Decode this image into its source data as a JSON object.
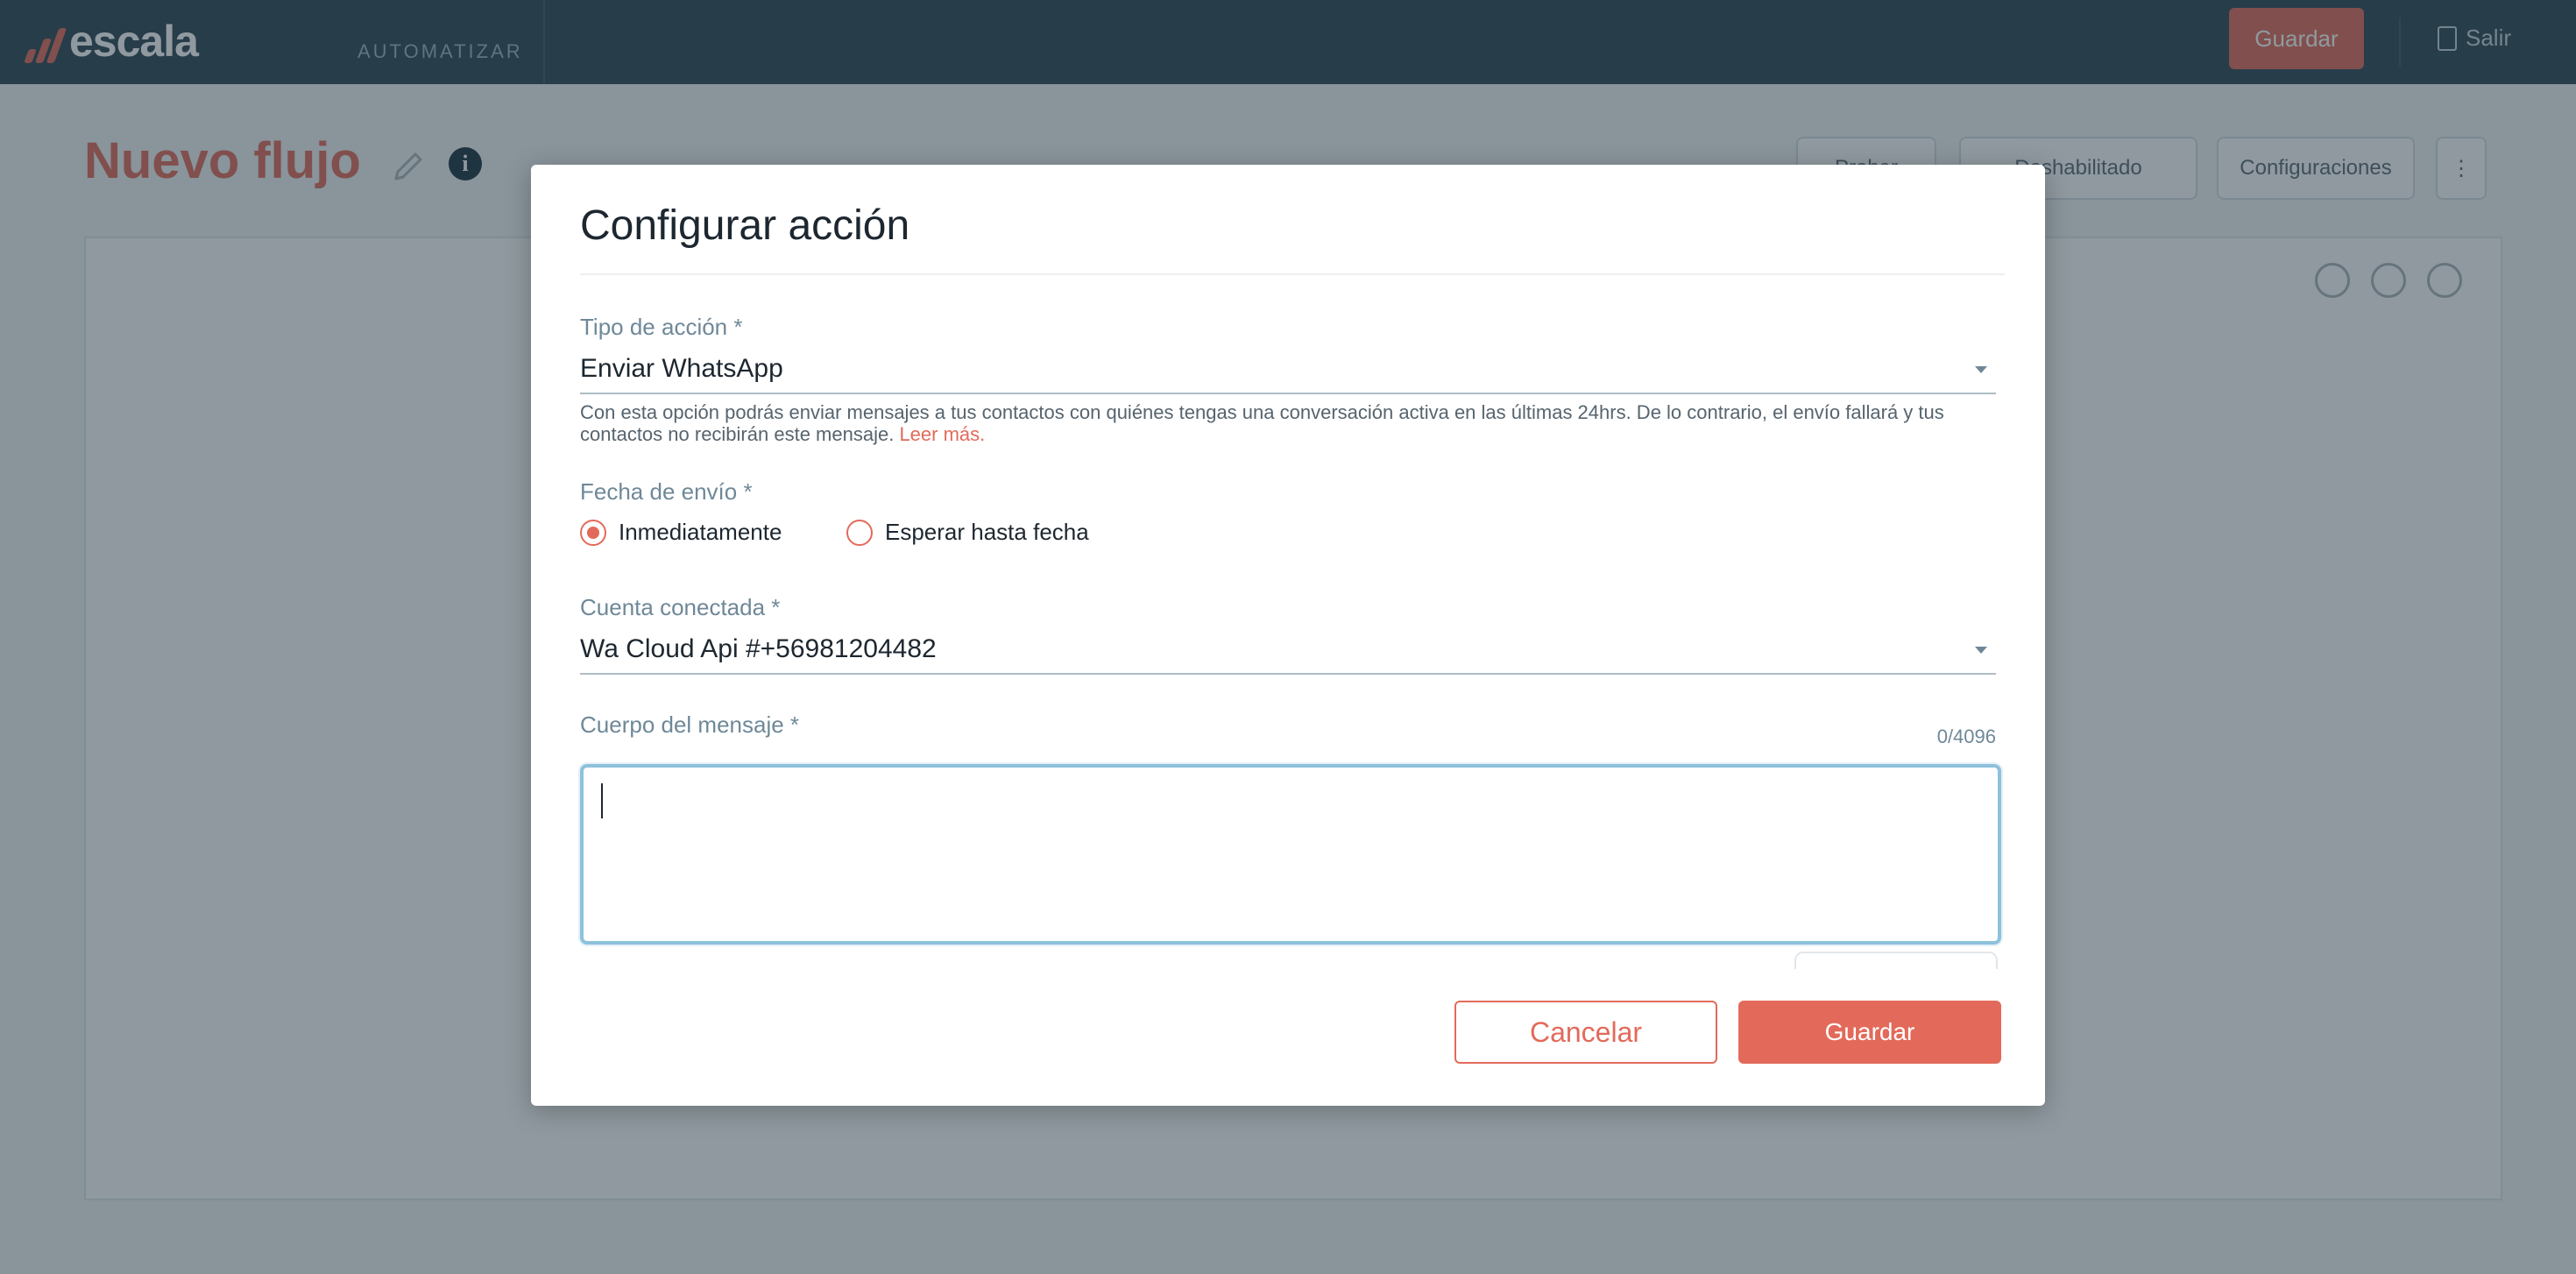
{
  "app": {
    "brand": "escala",
    "module": "AUTOMATIZAR",
    "save_label": "Guardar",
    "exit_label": "Salir"
  },
  "flow": {
    "title": "Nuevo flujo",
    "toolbar": {
      "probar_label": "Probar",
      "status_label": "Deshabilitado",
      "settings_label": "Configuraciones",
      "more_label": "⋮"
    }
  },
  "modal": {
    "title": "Configurar acción",
    "action_type": {
      "label": "Tipo de acción *",
      "value": "Enviar WhatsApp",
      "help": "Con esta opción podrás enviar mensajes a tus contactos con quiénes tengas una conversación activa en las últimas 24hrs. De lo contrario, el envío fallará y tus contactos no recibirán este mensaje.",
      "help_link": "Leer más."
    },
    "send_date": {
      "label": "Fecha de envío *",
      "options": [
        {
          "label": "Inmediatamente",
          "checked": true
        },
        {
          "label": "Esperar hasta fecha",
          "checked": false
        }
      ]
    },
    "account": {
      "label": "Cuenta conectada *",
      "value": "Wa Cloud Api #+56981204482"
    },
    "body": {
      "label": "Cuerpo del mensaje *",
      "counter": "0/4096",
      "value": ""
    },
    "cancel_label": "Cancelar",
    "save_label": "Guardar"
  },
  "colors": {
    "accent": "#e36a5a",
    "topbar": "#2f4654",
    "label": "#6f8898",
    "focus": "#8ec1dc"
  }
}
